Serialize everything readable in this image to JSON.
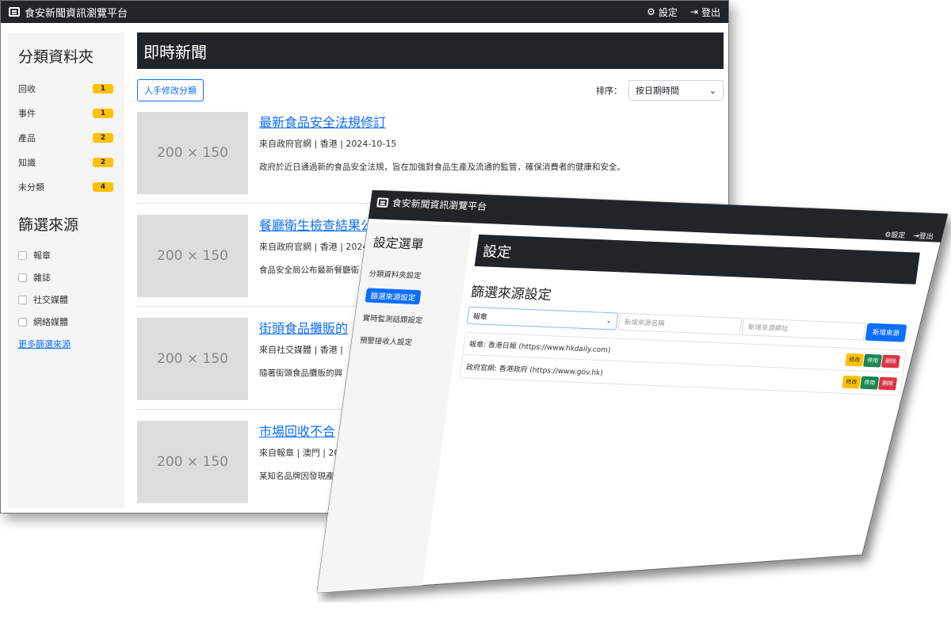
{
  "back": {
    "brand": "食安新聞資訊瀏覽平台",
    "nav": {
      "settings": "設定",
      "logout": "登出"
    },
    "sidebar": {
      "folders_heading": "分類資料夾",
      "folders": [
        {
          "label": "回收",
          "count": "1"
        },
        {
          "label": "事件",
          "count": "1"
        },
        {
          "label": "產品",
          "count": "2"
        },
        {
          "label": "知識",
          "count": "2"
        },
        {
          "label": "未分類",
          "count": "4"
        }
      ],
      "sources_heading": "篩選來源",
      "sources": [
        "報章",
        "雜誌",
        "社交媒體",
        "網絡媒體"
      ],
      "more_link": "更多篩選來源"
    },
    "main": {
      "title": "即時新聞",
      "manual_button": "人手修改分類",
      "sort_label": "排序：",
      "sort_value": "按日期時間",
      "news": [
        {
          "thumb": "200 × 150",
          "title": "最新食品安全法規修訂",
          "meta": "來自政府官網 | 香港 | 2024-10-15",
          "desc": "政府於近日通過新的食品安全法規，旨在加強對食品生產及流通的監管，確保消費者的健康和安全。"
        },
        {
          "thumb": "200 × 150",
          "title": "餐廳衛生檢查結果公",
          "meta": "來自政府官網 | 香港 | 2024-",
          "desc": "食品安全局公布最新餐廳衛"
        },
        {
          "thumb": "200 × 150",
          "title": "街頭食品攤販的",
          "meta": "來自社交媒體 | 香港 |",
          "desc": "隨著街頭食品攤販的興"
        },
        {
          "thumb": "200 × 150",
          "title": "市場回收不合",
          "meta": "來自報章 | 澳門 | 20",
          "desc": "某知名品牌因發現產"
        }
      ]
    }
  },
  "front": {
    "brand": "食安新聞資訊瀏覽平台",
    "nav": {
      "settings": "設定",
      "logout": "登出"
    },
    "sidebar": {
      "heading": "設定選單",
      "items": [
        "分類資料夾設定",
        "篩選來源設定",
        "實時監測話題設定",
        "預警接收人設定"
      ],
      "active_index": 1
    },
    "main": {
      "title": "設定",
      "subtitle": "篩選來源設定",
      "select_value": "報章",
      "name_placeholder": "新增來源名稱",
      "url_placeholder": "新增來源網址",
      "add_button": "新增來源",
      "sources": [
        {
          "text": "報章: 香港日報 (https://www.hkdaily.com)"
        },
        {
          "text": "政府官網: 香港政府 (https://www.gov.hk)"
        }
      ],
      "actions": {
        "edit": "修改",
        "stop": "停用",
        "delete": "刪除"
      }
    }
  },
  "colors": {
    "dark": "#212529",
    "primary": "#0d6efd",
    "warning": "#ffc107",
    "success": "#198754",
    "danger": "#dc3545"
  }
}
